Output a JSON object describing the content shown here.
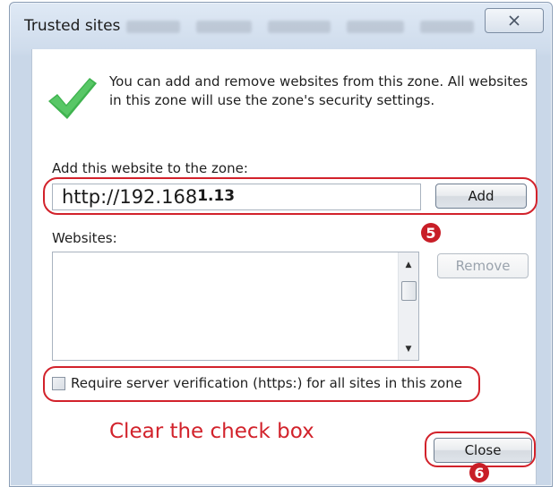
{
  "window": {
    "title": "Trusted sites",
    "close_glyph": "✕"
  },
  "info": {
    "text": "You can add and remove websites from this zone. All websites in this zone will use the zone's security settings."
  },
  "add_site": {
    "label": "Add this website to the zone:",
    "value_prefix": "http://192.168",
    "value_suffix": "1.13",
    "add_button": "Add"
  },
  "websites": {
    "label": "Websites:",
    "items": [],
    "remove_button": "Remove"
  },
  "https_option": {
    "label": "Require server verification (https:) for all sites in this zone",
    "checked": false
  },
  "annotations": {
    "step5": "5",
    "step6": "6",
    "hint": "Clear the check box",
    "color": "#d2222b"
  },
  "footer": {
    "close_button": "Close"
  }
}
